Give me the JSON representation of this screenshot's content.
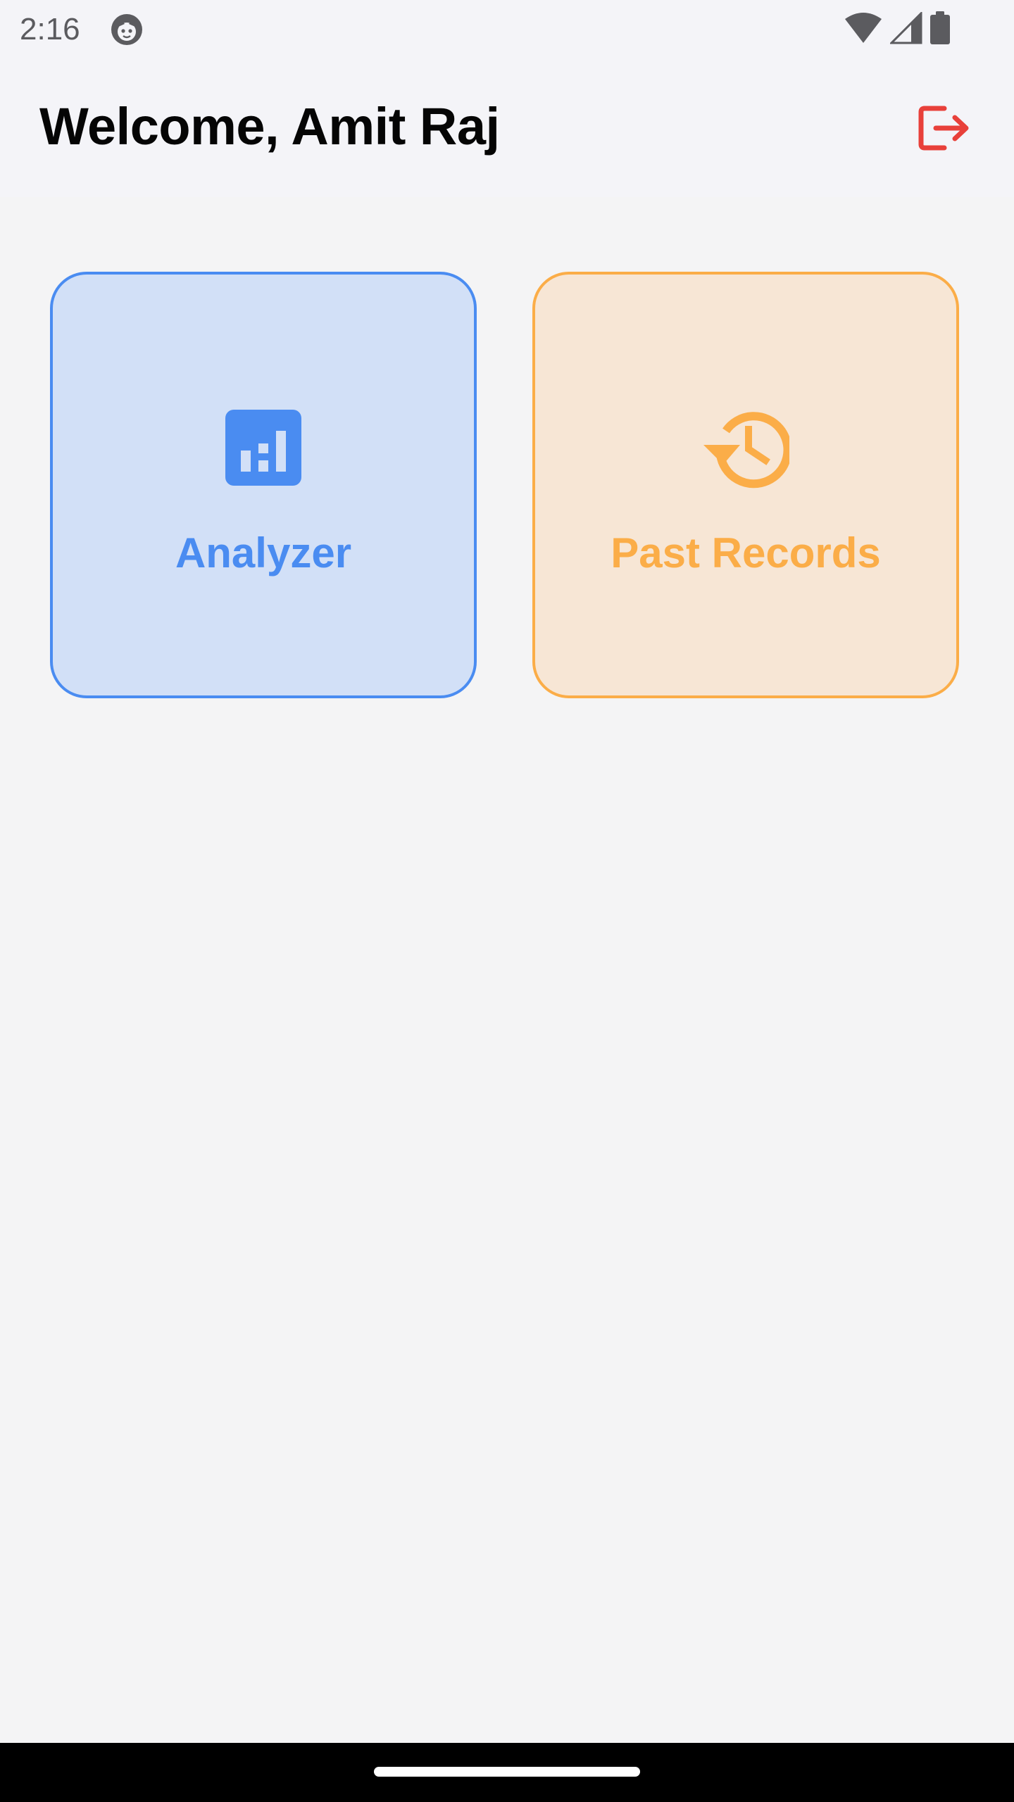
{
  "status_bar": {
    "time": "2:16",
    "icons": [
      "app-notification-icon",
      "wifi-icon",
      "cellular-signal-icon",
      "battery-icon"
    ]
  },
  "header": {
    "title": "Welcome, Amit Raj",
    "logout_icon": "logout-icon",
    "logout_color": "#e8403a"
  },
  "cards": [
    {
      "label": "Analyzer",
      "icon": "analytics-icon",
      "color": "#4a8cf1",
      "background": "#d2e0f7"
    },
    {
      "label": "Past Records",
      "icon": "history-icon",
      "color": "#fbad48",
      "background": "#f7e6d5"
    }
  ]
}
